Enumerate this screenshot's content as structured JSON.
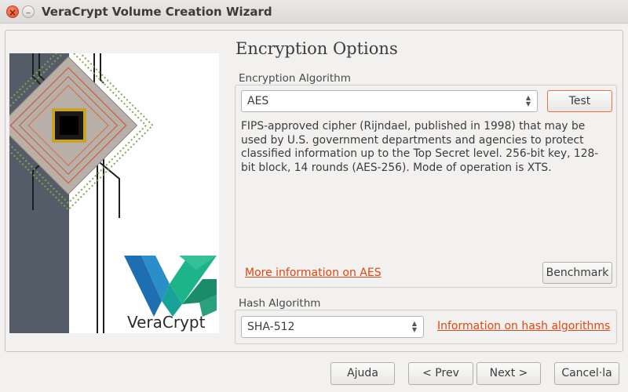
{
  "window": {
    "title": "VeraCrypt Volume Creation Wizard",
    "close_glyph": "×",
    "minimize_glyph": "–"
  },
  "page": {
    "heading": "Encryption Options"
  },
  "encryption": {
    "group_label": "Encryption Algorithm",
    "selected": "AES",
    "test_label": "Test",
    "description": "FIPS-approved cipher (Rijndael, published in 1998) that may be used by U.S. government departments and agencies to protect classified information up to the Top Secret level. 256-bit key, 128-bit block, 14 rounds (AES-256). Mode of operation is XTS.",
    "more_info_link": "More information on AES",
    "benchmark_label": "Benchmark"
  },
  "hash": {
    "group_label": "Hash Algorithm",
    "selected": "SHA-512",
    "info_link": "Information on hash algorithms"
  },
  "footer": {
    "help_label": "Ajuda",
    "prev_label": "< Prev",
    "next_label": "Next >",
    "cancel_label": "Cancel·la"
  },
  "logo": {
    "brand_text": "VeraCrypt"
  },
  "icons": {
    "combo_arrow_up": "▲",
    "combo_arrow_down": "▼"
  }
}
